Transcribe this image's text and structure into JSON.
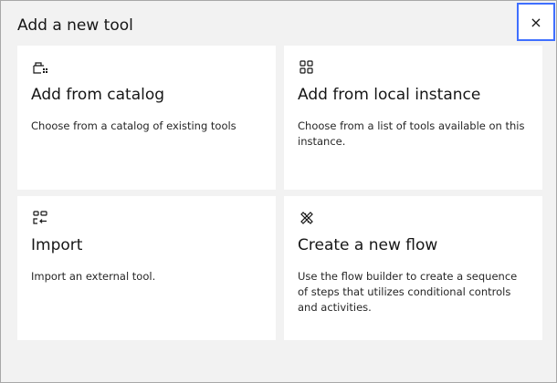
{
  "modal": {
    "title": "Add a new tool",
    "close_label": "×"
  },
  "tiles": [
    {
      "icon": "catalog-icon",
      "title": "Add from catalog",
      "description": "Choose from a catalog of existing tools"
    },
    {
      "icon": "grid-icon",
      "title": "Add from local instance",
      "description": "Choose from a list of tools available on this instance."
    },
    {
      "icon": "import-icon",
      "title": "Import",
      "description": "Import an external tool."
    },
    {
      "icon": "flow-icon",
      "title": "Create a new flow",
      "description": "Use the flow builder to create a sequence of steps that utilizes conditional controls and activities."
    }
  ],
  "colors": {
    "focus_border": "#3f6fff",
    "tile_bg": "#ffffff",
    "modal_bg": "#f2f2f2"
  }
}
